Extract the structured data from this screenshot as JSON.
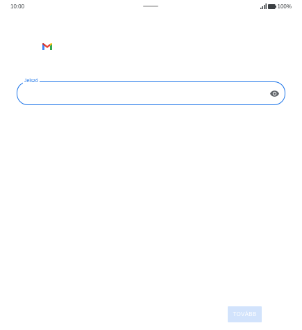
{
  "status_bar": {
    "time": "10:00",
    "battery": "100%",
    "signal_icon": "signal-icon",
    "battery_icon": "battery-icon"
  },
  "header": {
    "logo_icon": "gmail-logo-icon"
  },
  "password": {
    "label": "Jelszó",
    "value": "",
    "toggle_icon": "eye-icon"
  },
  "footer": {
    "next_label": "TOVÁBB"
  },
  "colors": {
    "accent": "#1a73e8",
    "disabled_button": "#d2e3fc"
  }
}
